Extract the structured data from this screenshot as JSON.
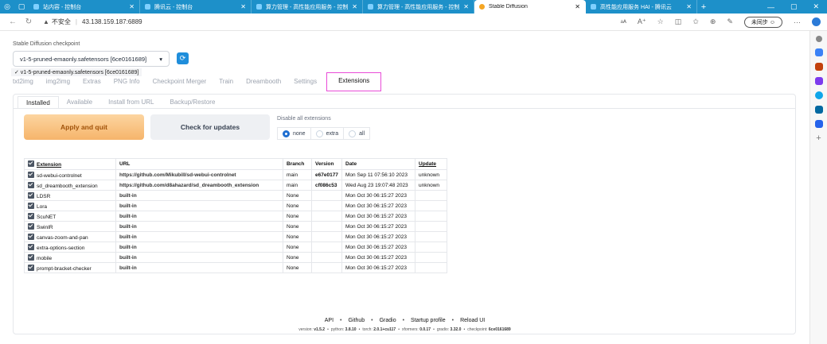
{
  "browser": {
    "tabs": [
      {
        "label": "站内容 - 控制台",
        "active": false
      },
      {
        "label": "腾讯云 - 控制台",
        "active": false
      },
      {
        "label": "算力管理 - 高性能应用服务 - 控制台",
        "active": false
      },
      {
        "label": "算力管理 - 高性能应用服务 - 控制台",
        "active": false
      },
      {
        "label": "Stable Diffusion",
        "active": true
      },
      {
        "label": "高性能应用服务 HAI - 腾讯云",
        "active": false
      }
    ],
    "security_label": "不安全",
    "url": "43.138.159.187:6889",
    "sync_label": "未同步",
    "icons": [
      "back-icon",
      "refresh-icon",
      "warning-icon",
      "read-aloud-icon",
      "favorite-icon",
      "split-screen-icon",
      "collections-icon",
      "extensions-icon",
      "profile-icon",
      "more-icon"
    ]
  },
  "checkpoint": {
    "label": "Stable Diffusion checkpoint",
    "selected": "v1-5-pruned-emaonly.safetensors [6ce0161689]",
    "option_shown": "✓ v1-5-pruned-emaonly.safetensors [6ce0161689]"
  },
  "main_tabs": [
    "txt2img",
    "img2img",
    "Extras",
    "PNG Info",
    "Checkpoint Merger",
    "Train",
    "Dreambooth",
    "Settings",
    "Extensions"
  ],
  "active_main_tab": "Extensions",
  "sub_tabs": [
    "Installed",
    "Available",
    "Install from URL",
    "Backup/Restore"
  ],
  "active_sub_tab": "Installed",
  "buttons": {
    "apply": "Apply and quit",
    "check": "Check for updates"
  },
  "disable": {
    "label": "Disable all extensions",
    "options": [
      "none",
      "extra",
      "all"
    ],
    "selected": "none"
  },
  "table": {
    "headers": [
      "Extension",
      "URL",
      "Branch",
      "Version",
      "Date",
      "Update"
    ],
    "rows": [
      {
        "name": "sd-webui-controlnet",
        "url": "https://github.com/Mikubill/sd-webui-controlnet",
        "branch": "main",
        "version": "e67e0177",
        "date": "Mon Sep 11 07:56:10 2023",
        "update": "unknown"
      },
      {
        "name": "sd_dreambooth_extension",
        "url": "https://github.com/d8ahazard/sd_dreambooth_extension",
        "branch": "main",
        "version": "cf086c53",
        "date": "Wed Aug 23 19:07:48 2023",
        "update": "unknown"
      },
      {
        "name": "LDSR",
        "url": "built-in",
        "branch": "None",
        "version": "",
        "date": "Mon Oct 30 06:15:27 2023",
        "update": ""
      },
      {
        "name": "Lora",
        "url": "built-in",
        "branch": "None",
        "version": "",
        "date": "Mon Oct 30 06:15:27 2023",
        "update": ""
      },
      {
        "name": "ScuNET",
        "url": "built-in",
        "branch": "None",
        "version": "",
        "date": "Mon Oct 30 06:15:27 2023",
        "update": ""
      },
      {
        "name": "SwinIR",
        "url": "built-in",
        "branch": "None",
        "version": "",
        "date": "Mon Oct 30 06:15:27 2023",
        "update": ""
      },
      {
        "name": "canvas-zoom-and-pan",
        "url": "built-in",
        "branch": "None",
        "version": "",
        "date": "Mon Oct 30 06:15:27 2023",
        "update": ""
      },
      {
        "name": "extra-options-section",
        "url": "built-in",
        "branch": "None",
        "version": "",
        "date": "Mon Oct 30 06:15:27 2023",
        "update": ""
      },
      {
        "name": "mobile",
        "url": "built-in",
        "branch": "None",
        "version": "",
        "date": "Mon Oct 30 06:15:27 2023",
        "update": ""
      },
      {
        "name": "prompt-bracket-checker",
        "url": "built-in",
        "branch": "None",
        "version": "",
        "date": "Mon Oct 30 06:15:27 2023",
        "update": ""
      }
    ]
  },
  "footer": {
    "links": [
      "API",
      "Github",
      "Gradio",
      "Startup profile",
      "Reload UI"
    ],
    "separator": "•",
    "version_items": [
      {
        "label": "version: ",
        "value": "v1.5.2"
      },
      {
        "label": "python: ",
        "value": "3.8.10"
      },
      {
        "label": "torch: ",
        "value": "2.0.1+cu117"
      },
      {
        "label": "xformers: ",
        "value": "0.0.17"
      },
      {
        "label": "gradio: ",
        "value": "3.32.0"
      },
      {
        "label": "checkpoint: ",
        "value": "6ce0161689"
      }
    ]
  },
  "colors": {
    "tabbar": "#1d90c9",
    "accent_pink": "#e94cd8",
    "apply_orange": "#f6b56b",
    "radio_blue": "#1f6fd1"
  }
}
